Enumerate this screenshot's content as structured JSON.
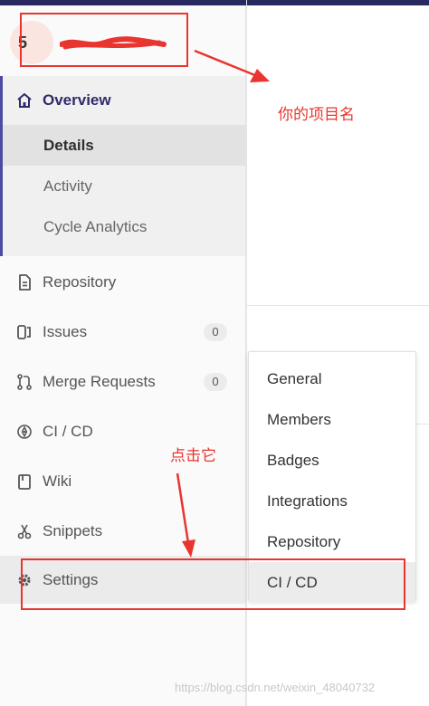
{
  "project": {
    "avatar_letter": "5",
    "name_redacted": true
  },
  "sidebar": {
    "overview": {
      "label": "Overview",
      "icon": "home-icon",
      "subitems": [
        {
          "label": "Details",
          "active": true
        },
        {
          "label": "Activity",
          "active": false
        },
        {
          "label": "Cycle Analytics",
          "active": false
        }
      ]
    },
    "items": [
      {
        "label": "Repository",
        "icon": "document-icon"
      },
      {
        "label": "Issues",
        "icon": "issues-icon",
        "count": "0"
      },
      {
        "label": "Merge Requests",
        "icon": "merge-request-icon",
        "count": "0"
      },
      {
        "label": "CI / CD",
        "icon": "rocket-icon"
      },
      {
        "label": "Wiki",
        "icon": "book-icon"
      },
      {
        "label": "Snippets",
        "icon": "scissors-icon"
      },
      {
        "label": "Settings",
        "icon": "gear-icon"
      }
    ]
  },
  "settings_flyout": {
    "items": [
      {
        "label": "General"
      },
      {
        "label": "Members"
      },
      {
        "label": "Badges"
      },
      {
        "label": "Integrations"
      },
      {
        "label": "Repository"
      },
      {
        "label": "CI / CD",
        "active": true
      }
    ]
  },
  "annotations": {
    "project_name_note": "你的项目名",
    "click_note": "点击它",
    "color": "#e8352f"
  },
  "watermark": "https://blog.csdn.net/weixin_48040732",
  "colors": {
    "topbar": "#292961",
    "active_accent": "#4b4ba3",
    "annotation": "#e8352f"
  }
}
